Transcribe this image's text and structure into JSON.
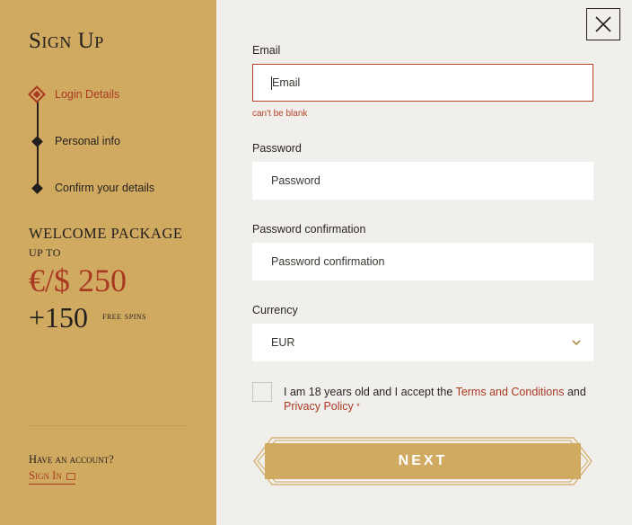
{
  "sidebar": {
    "title": "Sign Up",
    "steps": [
      {
        "label": "Login Details",
        "active": true
      },
      {
        "label": "Personal info",
        "active": false
      },
      {
        "label": "Confirm your details",
        "active": false
      }
    ],
    "promo": {
      "line1": "WELCOME PACKAGE",
      "line2": "UP TO",
      "amount": "€/$ 250",
      "spins_count": "+150",
      "spins_label": "free spins"
    },
    "have_account": "Have an account?",
    "signin_label": "Sign In",
    "signin_icon": "signin-icon"
  },
  "form": {
    "email": {
      "label": "Email",
      "placeholder": "Email",
      "value": "",
      "error": "can't be blank"
    },
    "password": {
      "label": "Password",
      "placeholder": "Password",
      "value": ""
    },
    "password_confirmation": {
      "label": "Password confirmation",
      "placeholder": "Password confirmation",
      "value": ""
    },
    "currency": {
      "label": "Currency",
      "selected": "EUR"
    },
    "consent": {
      "prefix": "I am 18 years old and I accept the ",
      "terms_link": "Terms and Conditions",
      "middle": " and",
      "privacy_link": "Privacy Policy",
      "required_mark": "*"
    },
    "next_label": "NEXT"
  },
  "colors": {
    "sidebar_bg": "#d1aa62",
    "accent_red": "#a93a22",
    "text_dark": "#231f1c",
    "main_bg": "#f0efec"
  }
}
